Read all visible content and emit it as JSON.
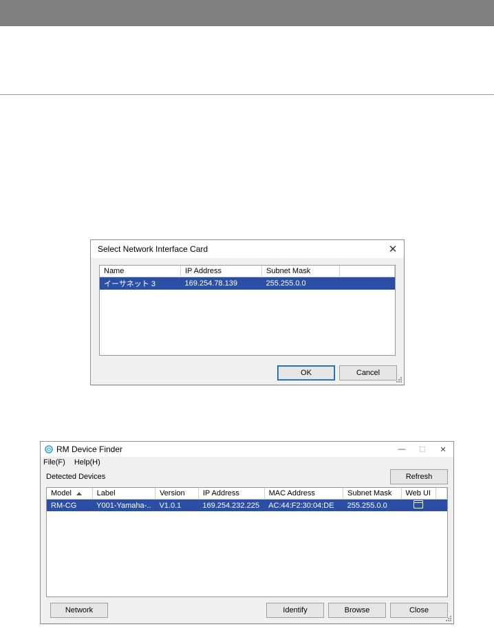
{
  "dialog_nic": {
    "title": "Select Network Interface Card",
    "columns": [
      "Name",
      "IP Address",
      "Subnet Mask"
    ],
    "rows": [
      {
        "name": "イーサネット 3",
        "ip": "169.254.78.139",
        "mask": "255.255.0.0"
      }
    ],
    "buttons": {
      "ok": "OK",
      "cancel": "Cancel"
    }
  },
  "dialog_finder": {
    "title": "RM Device Finder",
    "menu": {
      "file": "File(F)",
      "help": "Help(H)"
    },
    "detected_label": "Detected Devices",
    "refresh_label": "Refresh",
    "columns": [
      "Model",
      "Label",
      "Version",
      "IP Address",
      "MAC Address",
      "Subnet Mask",
      "Web UI"
    ],
    "rows": [
      {
        "model": "RM-CG",
        "label": "Y001-Yamaha-..",
        "version": "V1.0.1",
        "ip": "169.254.232.225",
        "mac": "AC:44:F2:30:04:DE",
        "mask": "255.255.0.0"
      }
    ],
    "buttons": {
      "network": "Network",
      "identify": "Identify",
      "browse": "Browse",
      "close": "Close"
    }
  }
}
